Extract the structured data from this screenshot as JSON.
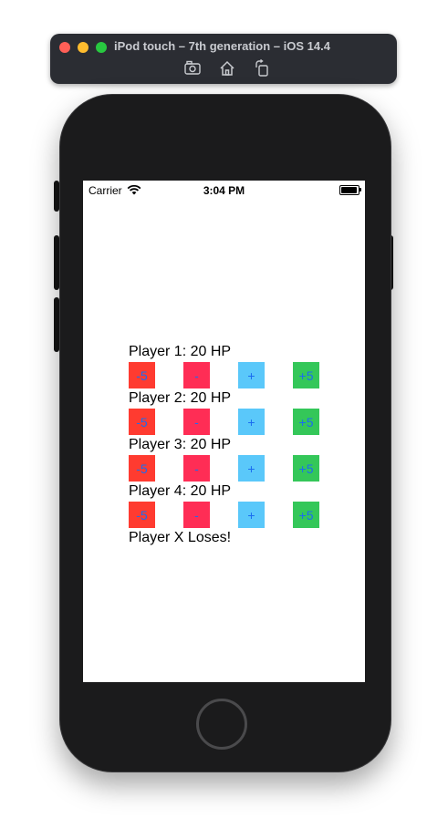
{
  "simulator": {
    "title": "iPod touch – 7th generation – iOS 14.4",
    "tools": [
      "screenshot-icon",
      "home-icon",
      "rotate-icon"
    ]
  },
  "status_bar": {
    "carrier": "Carrier",
    "time": "3:04 PM"
  },
  "players": [
    {
      "label": "Player 1: 20 HP"
    },
    {
      "label": "Player 2: 20 HP"
    },
    {
      "label": "Player 3: 20 HP"
    },
    {
      "label": "Player 4: 20 HP"
    }
  ],
  "buttons": {
    "minus5": {
      "label": "-5",
      "color": "#ff3b30"
    },
    "minus1": {
      "label": "-",
      "color": "#ff2d55"
    },
    "plus1": {
      "label": "+",
      "color": "#5ac8fa"
    },
    "plus5": {
      "label": "+5",
      "color": "#34c759"
    },
    "text_color": "#1a6df0"
  },
  "result": "Player X Loses!"
}
